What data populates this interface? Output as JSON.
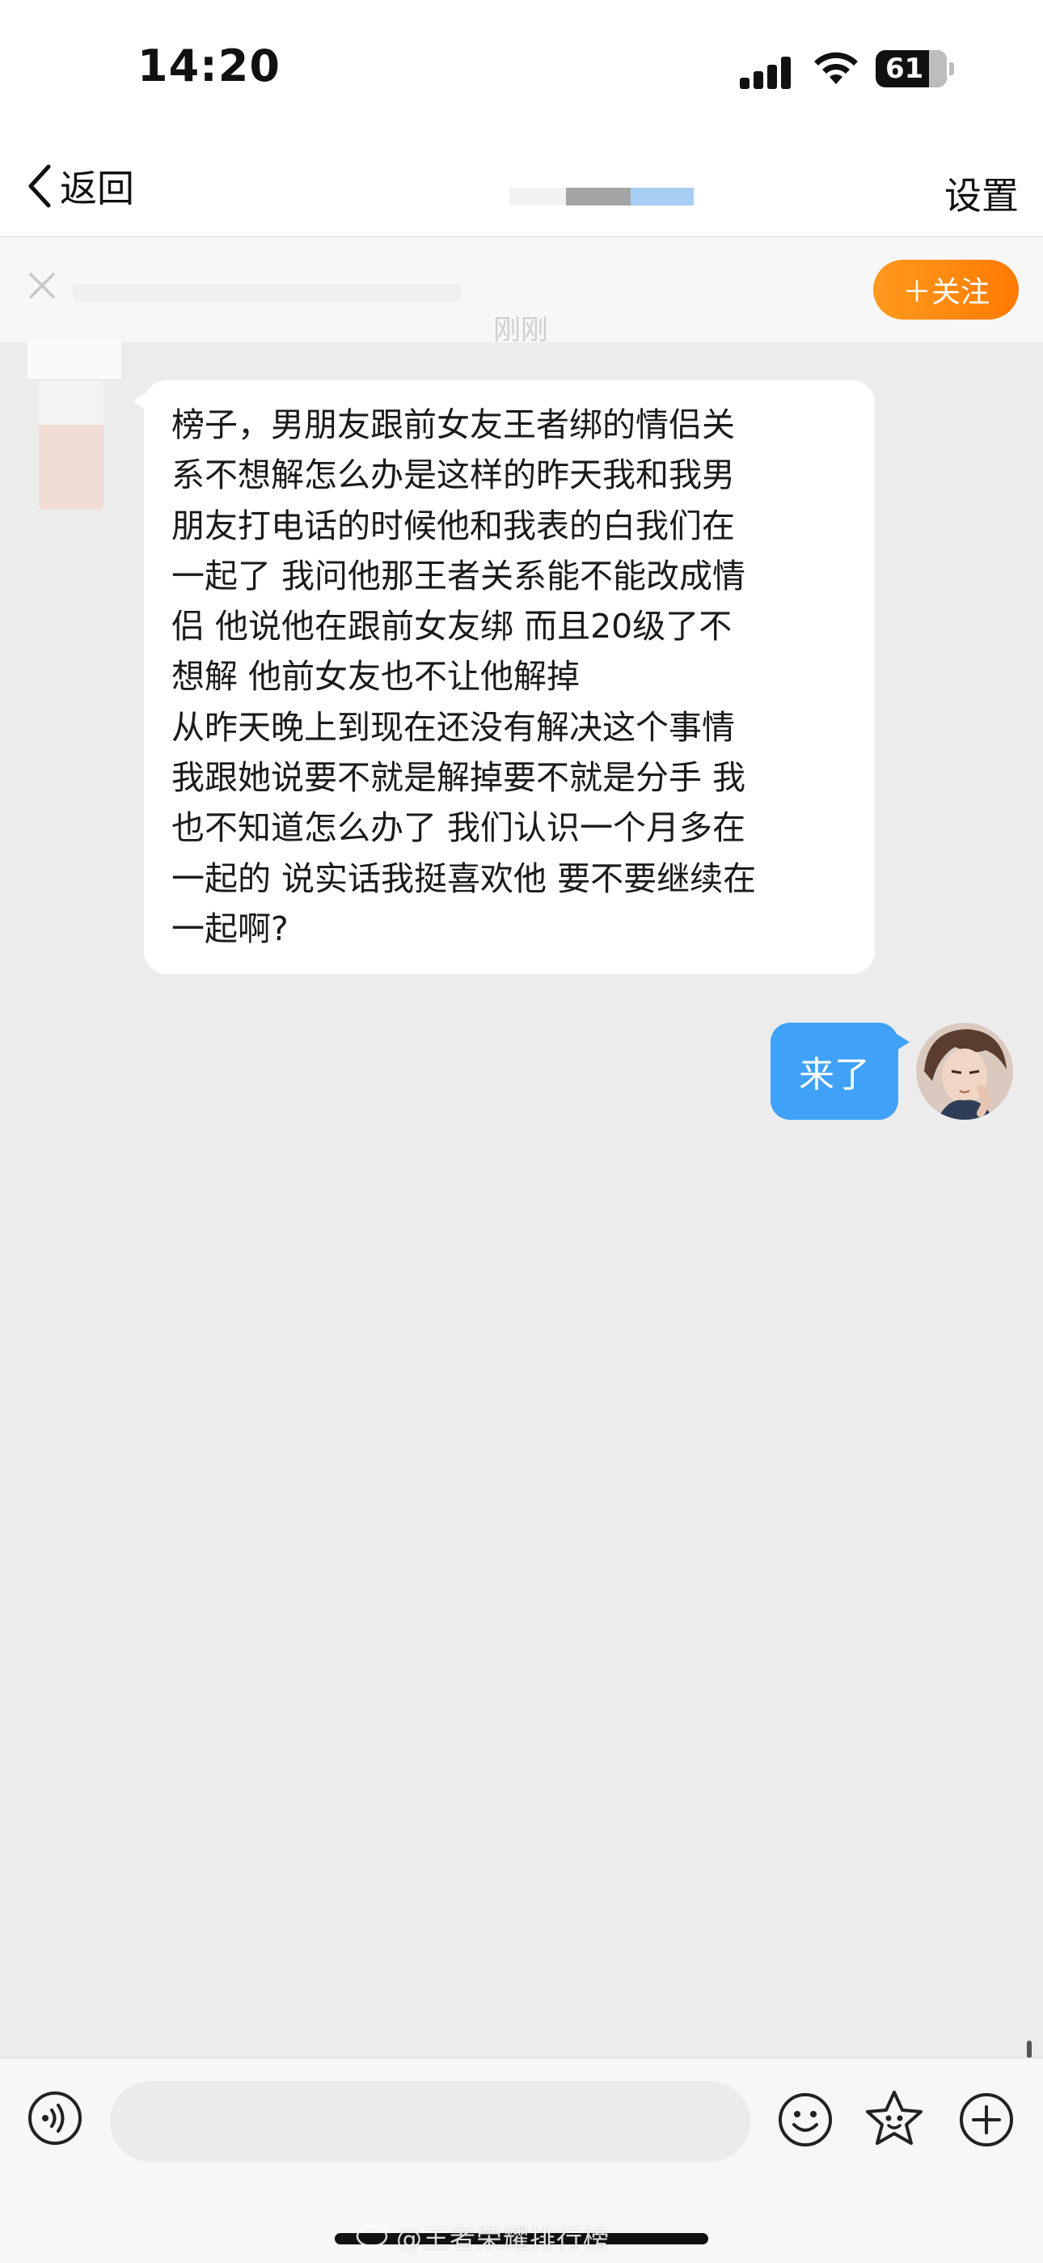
{
  "status": {
    "time": "14:20",
    "battery": "61"
  },
  "nav": {
    "back_label": "返回",
    "settings_label": "设置"
  },
  "banner": {
    "follow_label": "＋关注",
    "timestamp": "刚刚"
  },
  "messages": {
    "incoming": "榜子，男朋友跟前女友王者绑的情侣关\n系不想解怎么办是这样的昨天我和我男\n朋友打电话的时候他和我表的白我们在\n一起了 我问他那王者关系能不能改成情\n侣 他说他在跟前女友绑 而且20级了不\n想解 他前女友也不让他解掉\n从昨天晚上到现在还没有解决这个事情\n我跟她说要不就是解掉要不就是分手 我\n也不知道怎么办了 我们认识一个月多在\n一起的 说实话我挺喜欢他 要不要继续在\n一起啊?",
    "outgoing": "来了"
  },
  "input": {
    "placeholder": ""
  },
  "watermark": "@王者荣耀排行榜",
  "colors": {
    "accent_blue": "#3fa1f7",
    "follow_orange": "#ff8a00",
    "background": "#ececec"
  }
}
